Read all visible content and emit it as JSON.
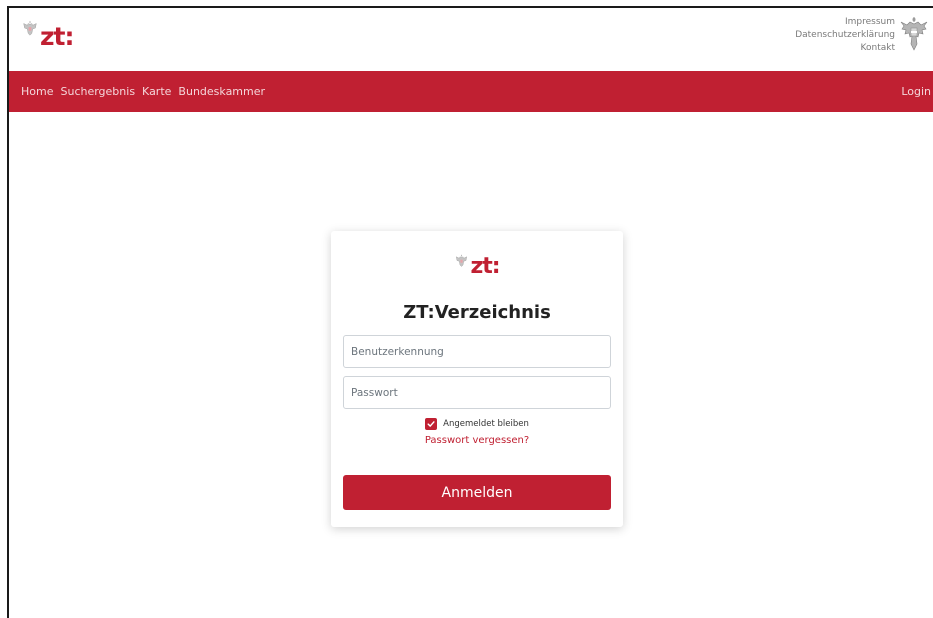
{
  "header": {
    "logo_text": "zt:",
    "links": [
      "Impressum",
      "Datenschutzerklärung",
      "Kontakt"
    ]
  },
  "nav": {
    "items": [
      "Home",
      "Suchergebnis",
      "Karte",
      "Bundeskammer"
    ],
    "login_label": "Login"
  },
  "login": {
    "logo_text": "zt:",
    "title": "ZT:Verzeichnis",
    "username_placeholder": "Benutzerkennung",
    "password_placeholder": "Passwort",
    "remember_label": "Angemeldet bleiben",
    "remember_checked": true,
    "forgot_label": "Passwort vergessen?",
    "submit_label": "Anmelden"
  },
  "colors": {
    "brand": "#c02032",
    "background": "#ffffff"
  },
  "icons": [
    "eagle-crest-icon",
    "eagle-coat-of-arms-icon",
    "check-icon"
  ]
}
